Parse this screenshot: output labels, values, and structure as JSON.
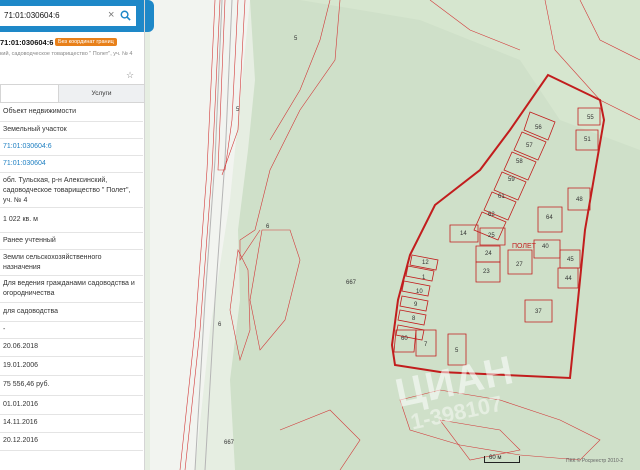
{
  "search": {
    "query": "71:01:030604:6"
  },
  "object": {
    "number": "71:01:030604:6",
    "badge": "Без координат границ",
    "address_short": "кий, садоводческое товарищество \" Полет\", уч. № 4"
  },
  "tabs": {
    "info": "",
    "services": "Услуги"
  },
  "rows": [
    {
      "text": "Объект недвижимости",
      "link": false
    },
    {
      "text": "Земельный участок",
      "link": false
    },
    {
      "text": "71:01:030604:6",
      "link": true
    },
    {
      "text": "71:01:030604",
      "link": true
    },
    {
      "text": "обл. Тульская, р-н Алексинский, садоводческое товарищество \" Полет\", уч. № 4",
      "link": false
    },
    {
      "text": "1 022 кв. м",
      "link": false
    },
    {
      "text": "Ранее учтенный",
      "link": false
    },
    {
      "text": "Земли сельскохозяйственного назначения",
      "link": false
    },
    {
      "text": "Для ведения гражданами садоводства и огородничества",
      "link": false
    },
    {
      "text": "для садоводства",
      "link": false
    },
    {
      "text": "-",
      "link": false
    },
    {
      "text": "20.06.2018",
      "link": false
    },
    {
      "text": "19.01.2006",
      "link": false
    },
    {
      "text": "75 556,46 руб.",
      "link": false
    },
    {
      "text": "01.01.2016",
      "link": false
    },
    {
      "text": "14.11.2016",
      "link": false
    },
    {
      "text": "20.12.2016",
      "link": false
    }
  ],
  "map": {
    "parcel_labels": [
      "5",
      "5",
      "6",
      "6",
      "667",
      "667",
      "56",
      "55",
      "57",
      "51",
      "58",
      "59",
      "48",
      "61",
      "62",
      "64",
      "14",
      "25",
      "40",
      "12",
      "24",
      "27",
      "45",
      "1",
      "23",
      "44",
      "10",
      "9",
      "37",
      "8",
      "60",
      "7",
      "5"
    ],
    "place_label": "ПОЛЕТ",
    "scale": "60 м",
    "copyright": "ПКК © Росреестр 2010-2",
    "watermark": "ЦИАН",
    "watermark_id": "1-398107"
  },
  "colors": {
    "accent": "#1e88c8",
    "boundary": "#c21d1d",
    "badge": "#e8801a"
  },
  "icons": {
    "search": "search-icon",
    "clear": "close-icon",
    "favorite": "star-icon"
  }
}
